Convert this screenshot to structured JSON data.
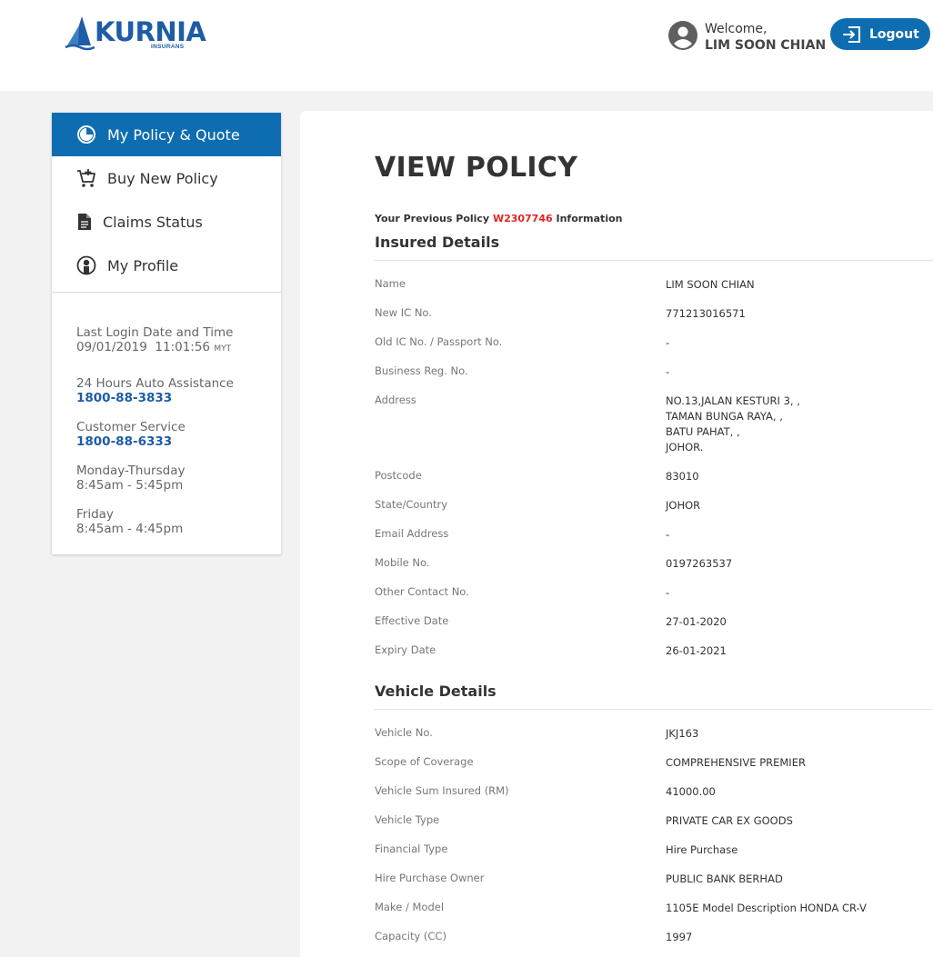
{
  "header": {
    "logo_name": "KURNIA",
    "logo_sub": "INSURANS",
    "welcome_label": "Welcome,",
    "user_name": "LIM SOON CHIAN",
    "logout_label": "Logout"
  },
  "sidebar": {
    "items": [
      {
        "label": "My Policy & Quote",
        "icon": "policy-icon",
        "active": true
      },
      {
        "label": "Buy New Policy",
        "icon": "cart-add-icon",
        "active": false
      },
      {
        "label": "Claims Status",
        "icon": "document-icon",
        "active": false
      },
      {
        "label": "My Profile",
        "icon": "profile-icon",
        "active": false
      }
    ],
    "last_login_label": "Last Login Date and Time",
    "last_login_value": "09/01/2019  11:01:56",
    "last_login_tz": "MYT",
    "assist_label": "24 Hours Auto Assistance",
    "assist_phone": "1800-88-3833",
    "cs_label": "Customer Service",
    "cs_phone": "1800-88-6333",
    "hours1_days": "Monday-Thursday",
    "hours1_time": "8:45am - 5:45pm",
    "hours2_days": "Friday",
    "hours2_time": "8:45am - 4:45pm"
  },
  "main": {
    "title": "VIEW POLICY",
    "prev_policy_prefix": "Your Previous Policy ",
    "prev_policy_no": "W2307746",
    "prev_policy_suffix": " Information",
    "insured": {
      "title": "Insured Details",
      "rows": [
        {
          "label": "Name",
          "value": "LIM SOON CHIAN"
        },
        {
          "label": "New IC No.",
          "value": "771213016571"
        },
        {
          "label": "Old IC No. / Passport No.",
          "value": "-"
        },
        {
          "label": "Business Reg. No.",
          "value": "-"
        },
        {
          "label": "Address",
          "value": "NO.13,JALAN KESTURI 3, ,\nTAMAN BUNGA RAYA, ,\nBATU PAHAT, ,\nJOHOR."
        },
        {
          "label": "Postcode",
          "value": "83010"
        },
        {
          "label": "State/Country",
          "value": "JOHOR"
        },
        {
          "label": "Email Address",
          "value": "-"
        },
        {
          "label": "Mobile No.",
          "value": "0197263537"
        },
        {
          "label": "Other Contact No.",
          "value": "-"
        },
        {
          "label": "Effective Date",
          "value": "27-01-2020"
        },
        {
          "label": "Expiry Date",
          "value": "26-01-2021"
        }
      ]
    },
    "vehicle": {
      "title": "Vehicle Details",
      "rows": [
        {
          "label": "Vehicle No.",
          "value": "JKJ163"
        },
        {
          "label": "Scope of Coverage",
          "value": "COMPREHENSIVE PREMIER"
        },
        {
          "label": "Vehicle Sum Insured (RM)",
          "value": "41000.00"
        },
        {
          "label": "Vehicle Type",
          "value": "PRIVATE CAR EX GOODS"
        },
        {
          "label": "Financial Type",
          "value": "Hire Purchase"
        },
        {
          "label": "Hire Purchase Owner",
          "value": "PUBLIC BANK BERHAD"
        },
        {
          "label": "Make / Model",
          "value": "1105E Model Description HONDA CR-V"
        },
        {
          "label": "Capacity (CC)",
          "value": "1997"
        }
      ]
    }
  },
  "colors": {
    "brand_blue": "#0e6db0",
    "logo_blue": "#1e5da6",
    "policy_red": "#e02424"
  }
}
